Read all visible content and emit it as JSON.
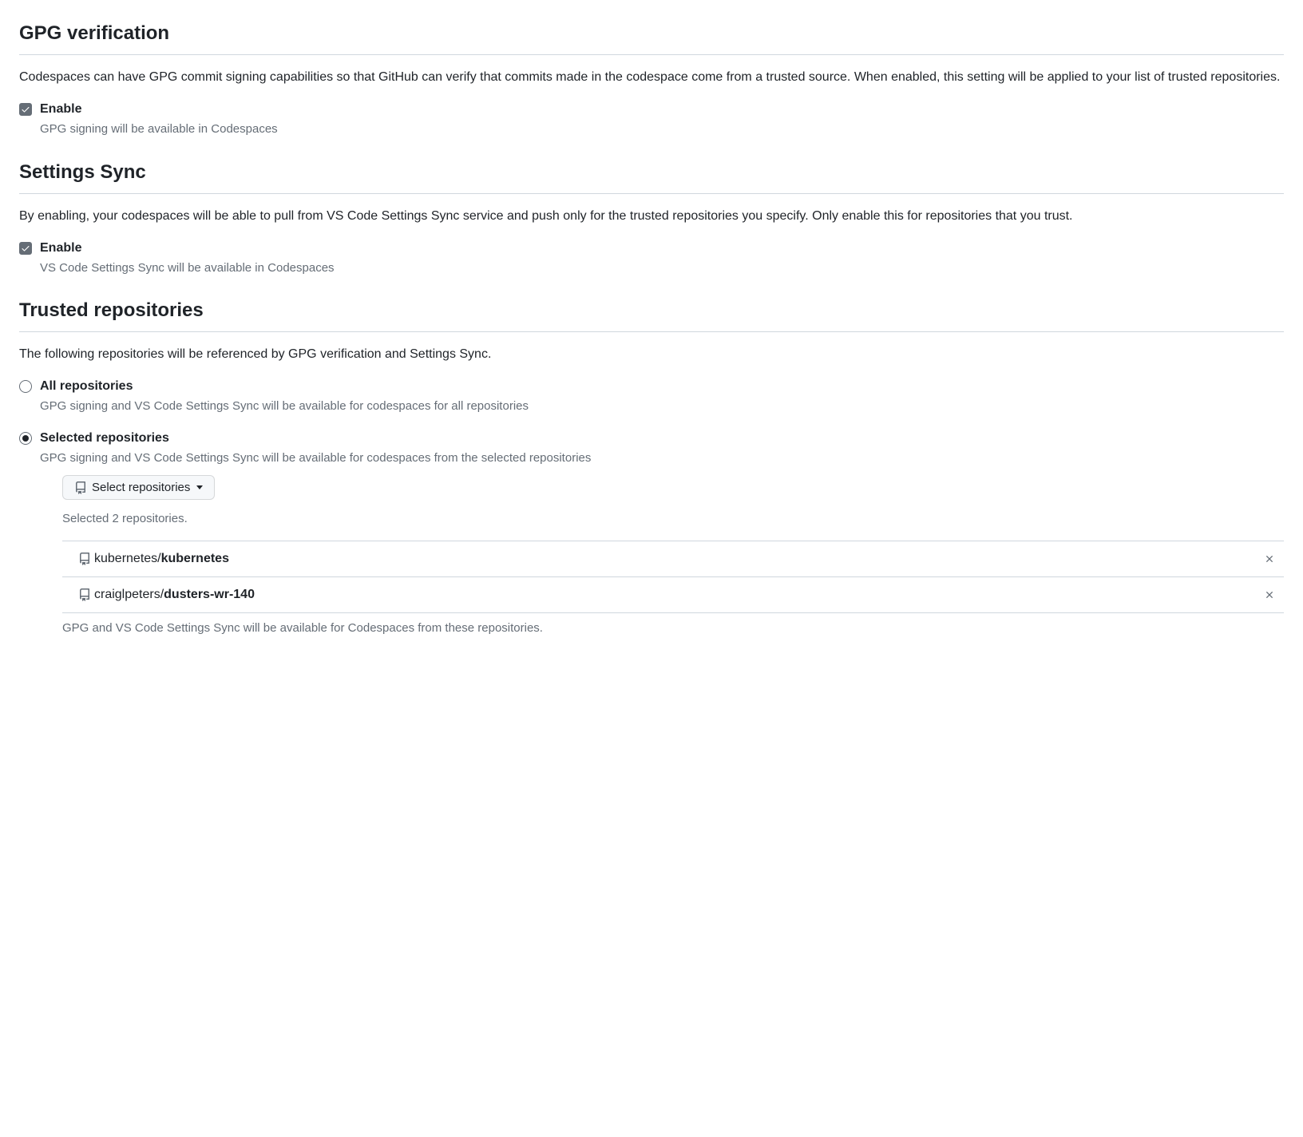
{
  "gpg": {
    "heading": "GPG verification",
    "desc": "Codespaces can have GPG commit signing capabilities so that GitHub can verify that commits made in the codespace come from a trusted source. When enabled, this setting will be applied to your list of trusted repositories.",
    "enable_label": "Enable",
    "enable_sub": "GPG signing will be available in Codespaces",
    "enable_checked": true
  },
  "sync": {
    "heading": "Settings Sync",
    "desc": "By enabling, your codespaces will be able to pull from VS Code Settings Sync service and push only for the trusted repositories you specify. Only enable this for repositories that you trust.",
    "enable_label": "Enable",
    "enable_sub": "VS Code Settings Sync will be available in Codespaces",
    "enable_checked": true
  },
  "trusted": {
    "heading": "Trusted repositories",
    "desc": "The following repositories will be referenced by GPG verification and Settings Sync.",
    "options": {
      "all": {
        "label": "All repositories",
        "sub": "GPG signing and VS Code Settings Sync will be available for codespaces for all repositories",
        "selected": false
      },
      "selected": {
        "label": "Selected repositories",
        "sub": "GPG signing and VS Code Settings Sync will be available for codespaces from the selected repositories",
        "selected": true
      }
    },
    "selector": {
      "button_label": "Select repositories",
      "count_text": "Selected 2 repositories."
    },
    "repos": [
      {
        "owner": "kubernetes/",
        "name": "kubernetes"
      },
      {
        "owner": "craiglpeters/",
        "name": "dusters-wr-140"
      }
    ],
    "list_note": "GPG and VS Code Settings Sync will be available for Codespaces from these repositories."
  }
}
